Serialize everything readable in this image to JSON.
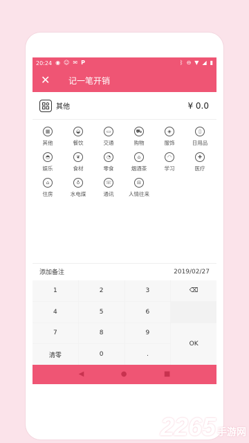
{
  "status_bar": {
    "time": "20:24",
    "left_icons": [
      "eye-icon",
      "cat-icon",
      "mail-icon",
      "parking-icon"
    ],
    "right_icons": [
      "bluetooth-icon",
      "dnd-icon",
      "wifi-icon",
      "signal-icon",
      "battery-icon"
    ]
  },
  "toolbar": {
    "title": "记一笔开销",
    "close_icon": "close-icon"
  },
  "selected": {
    "label": "其他",
    "amount": "¥ 0.0"
  },
  "categories": [
    {
      "label": "其他",
      "glyph": "▦"
    },
    {
      "label": "餐饮",
      "glyph": "◒"
    },
    {
      "label": "交通",
      "glyph": "▭"
    },
    {
      "label": "购物",
      "glyph": "⛟"
    },
    {
      "label": "服饰",
      "glyph": "◈"
    },
    {
      "label": "日用品",
      "glyph": "▯"
    },
    {
      "label": "娱乐",
      "glyph": "◓"
    },
    {
      "label": "食材",
      "glyph": "❦"
    },
    {
      "label": "零食",
      "glyph": "◔"
    },
    {
      "label": "烟酒茶",
      "glyph": "⌂"
    },
    {
      "label": "学习",
      "glyph": "◠"
    },
    {
      "label": "医疗",
      "glyph": "✚"
    },
    {
      "label": "住房",
      "glyph": "⌂"
    },
    {
      "label": "水电煤",
      "glyph": "♁"
    },
    {
      "label": "通讯",
      "glyph": "☏"
    },
    {
      "label": "人情往来",
      "glyph": "⊟"
    }
  ],
  "note": {
    "label": "添加备注",
    "date": "2019/02/27"
  },
  "keypad": {
    "k1": "1",
    "k2": "2",
    "k3": "3",
    "backspace": "⌫",
    "k4": "4",
    "k5": "5",
    "k6": "6",
    "k7": "7",
    "k8": "8",
    "k9": "9",
    "ok": "OK",
    "clear": "清零",
    "k0": "0",
    "dot": "."
  },
  "nav": {
    "back": "◀",
    "home": "●",
    "recents": "■"
  },
  "watermark": {
    "number": "2265",
    "text": "手游网"
  },
  "colors": {
    "accent": "#ef5574",
    "background": "#fbe3ea"
  }
}
